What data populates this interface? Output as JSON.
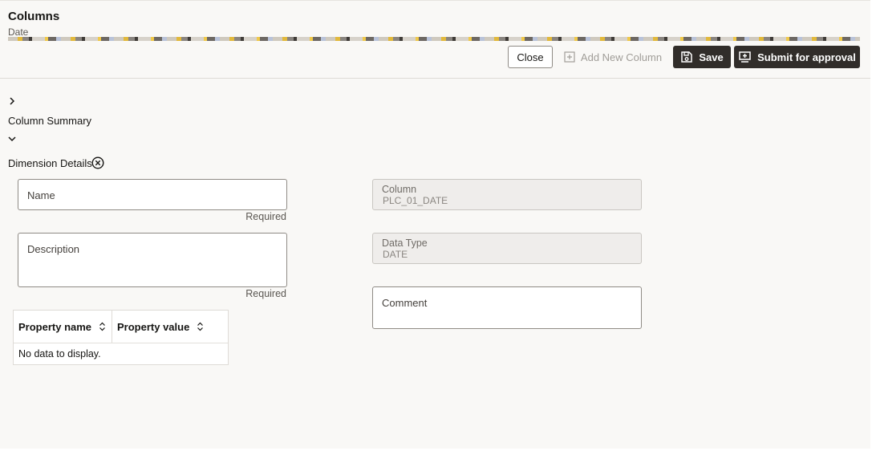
{
  "header": {
    "title": "Columns",
    "subtitle": "Date"
  },
  "toolbar": {
    "close_label": "Close",
    "add_column_label": "Add New Column",
    "save_label": "Save",
    "submit_label": "Submit for approval"
  },
  "sections": {
    "column_summary": "Column Summary",
    "dimension_details": "Dimension Details"
  },
  "form": {
    "name_label": "Name",
    "name_value": "",
    "name_hint": "Required",
    "description_label": "Description",
    "description_value": "",
    "description_hint": "Required",
    "column_label": "Column",
    "column_value": "PLC_01_DATE",
    "datatype_label": "Data Type",
    "datatype_value": "DATE",
    "comment_label": "Comment",
    "comment_value": ""
  },
  "properties_table": {
    "columns": [
      "Property name",
      "Property value"
    ],
    "empty_message": "No data to display."
  },
  "icons": {
    "add": "plus-square-icon",
    "save": "floppy-disk-icon",
    "submit": "submit-tray-icon",
    "expand": "chevron-right-icon",
    "collapse": "chevron-down-icon",
    "remove": "circle-x-icon",
    "sort": "sort-updown-icon"
  },
  "colors": {
    "primary_button": "#312d2a",
    "page_bg": "#f9f8f6"
  }
}
